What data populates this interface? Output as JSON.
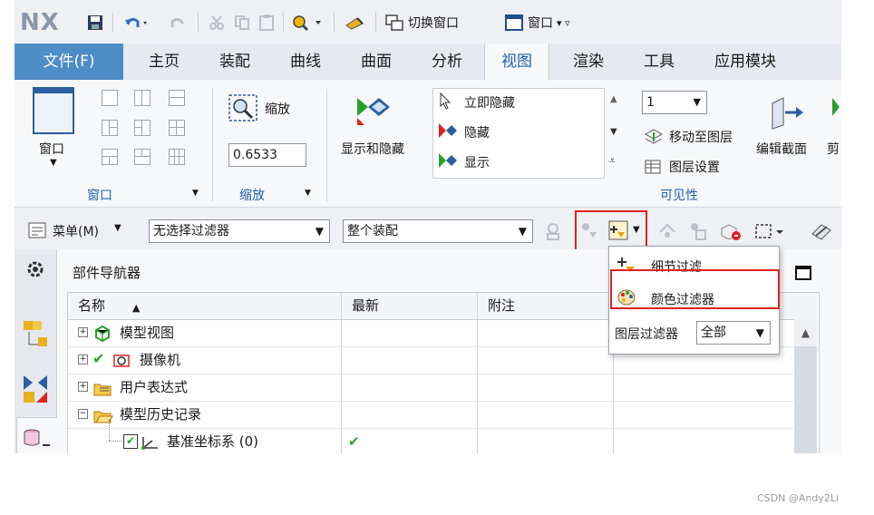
{
  "app": {
    "logo": "NX"
  },
  "quick_access": {
    "switch_window": "切换窗口",
    "window_menu": "窗口"
  },
  "tabs": [
    "文件(F)",
    "主页",
    "装配",
    "曲线",
    "曲面",
    "分析",
    "视图",
    "渲染",
    "工具",
    "应用模块"
  ],
  "active_tab": "视图",
  "ribbon": {
    "window_group": {
      "button": "窗口",
      "label": "窗口"
    },
    "zoom_group": {
      "button": "缩放",
      "value": "0.6533",
      "label": "缩放"
    },
    "show_hide": "显示和隐藏",
    "visibility_list": [
      "立即隐藏",
      "隐藏",
      "显示"
    ],
    "layer": {
      "value": "1",
      "move_to_layer": "移动至图层",
      "layer_settings": "图层设置"
    },
    "visibility_label": "可见性",
    "edit_section": "编辑截面",
    "cut_partial": "剪"
  },
  "selection_bar": {
    "menu": "菜单(M)",
    "type_filter": "无选择过滤器",
    "scope": "整个装配"
  },
  "popup": {
    "detail_filter": "细节过滤...",
    "color_filter": "颜色过滤器",
    "layer_filter_label": "图层过滤器",
    "layer_filter_value": "全部"
  },
  "navigator": {
    "title": "部件导航器",
    "columns": [
      "名称",
      "最新",
      "附注"
    ],
    "rows": [
      {
        "name": "模型视图",
        "latest": ""
      },
      {
        "name": "摄像机",
        "latest": ""
      },
      {
        "name": "用户表达式",
        "latest": ""
      },
      {
        "name": "模型历史记录",
        "latest": ""
      },
      {
        "name": "基准坐标系 (0)",
        "latest": "✔"
      }
    ]
  },
  "watermark": "CSDN @Andy2Li",
  "colors": {
    "file_tab": "#4e8cc7",
    "accent": "#1f5fae",
    "highlight": "#e02020",
    "check": "#2aa02a"
  }
}
